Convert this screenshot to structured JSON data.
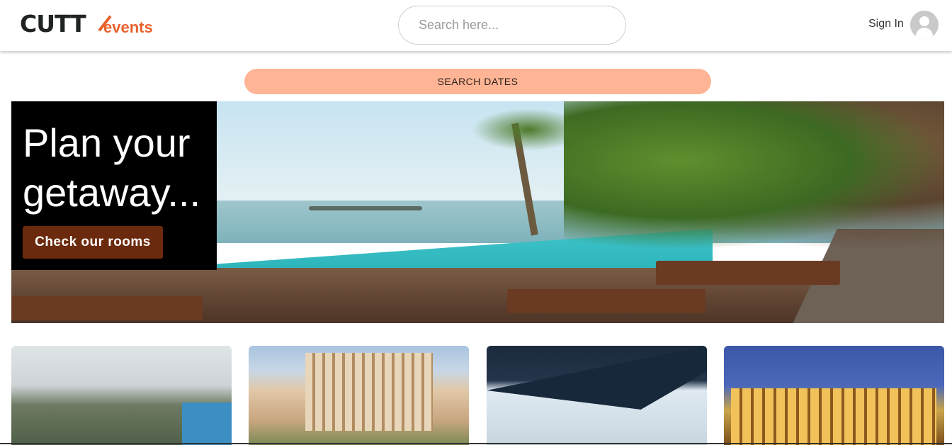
{
  "header": {
    "logo_text": "CUTT",
    "logo_subtext": "events",
    "search_placeholder": "Search here...",
    "sign_in_label": "Sign In"
  },
  "search_dates_label": "SEARCH DATES",
  "hero": {
    "headline": "Plan your getaway...",
    "cta_label": "Check our rooms"
  },
  "colors": {
    "brand_orange": "#e8622e",
    "search_dates_bg": "#ffb595",
    "cta_bg": "#6b2a0e",
    "promo_bg": "#000000"
  },
  "room_cards": [
    {
      "image": "coastal-town-photo"
    },
    {
      "image": "hotel-building-photo"
    },
    {
      "image": "shade-sail-photo"
    },
    {
      "image": "lit-palace-night-photo"
    }
  ]
}
